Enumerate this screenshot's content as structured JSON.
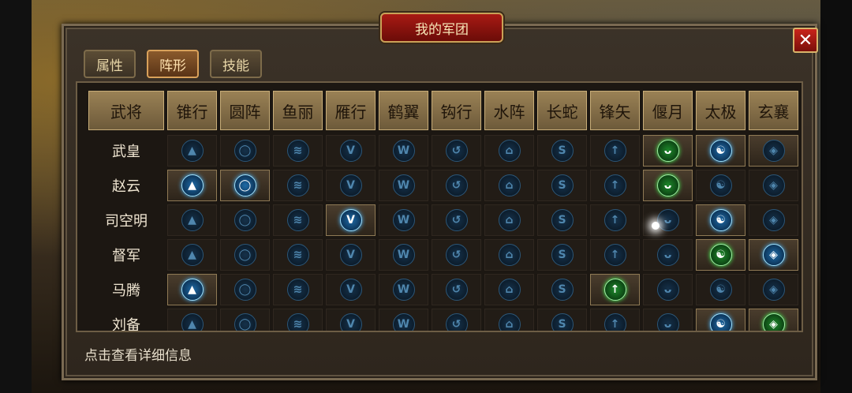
{
  "window": {
    "title": "我的军团",
    "close_label": "✕"
  },
  "tabs": [
    {
      "label": "属性",
      "active": false
    },
    {
      "label": "阵形",
      "active": true
    },
    {
      "label": "技能",
      "active": false
    }
  ],
  "formation_table": {
    "first_header": "武将",
    "columns": [
      "锥行",
      "圆阵",
      "鱼丽",
      "雁行",
      "鹤翼",
      "钩行",
      "水阵",
      "长蛇",
      "锋矢",
      "偃月",
      "太极",
      "玄襄"
    ],
    "icon_glyphs": [
      "▲",
      "◯",
      "≋",
      "V",
      "W",
      "↺",
      "⌂",
      "S",
      "↑",
      "ᴗ",
      "☯",
      "◈"
    ],
    "rows": [
      {
        "name": "武皇",
        "active": [
          false,
          false,
          false,
          false,
          false,
          false,
          false,
          false,
          false,
          true,
          true,
          true
        ],
        "lit": [
          0,
          0,
          0,
          0,
          0,
          0,
          0,
          0,
          0,
          "green",
          "blue",
          0
        ]
      },
      {
        "name": "赵云",
        "active": [
          true,
          true,
          false,
          false,
          false,
          false,
          false,
          false,
          false,
          true,
          false,
          false
        ],
        "lit": [
          "blue",
          "blue",
          0,
          0,
          0,
          0,
          0,
          0,
          0,
          "green",
          0,
          0
        ]
      },
      {
        "name": "司空明",
        "active": [
          false,
          false,
          false,
          true,
          false,
          false,
          false,
          false,
          false,
          false,
          true,
          false
        ],
        "lit": [
          0,
          0,
          0,
          "blue",
          0,
          0,
          0,
          0,
          0,
          0,
          "blue",
          0
        ]
      },
      {
        "name": "督军",
        "active": [
          false,
          false,
          false,
          false,
          false,
          false,
          false,
          false,
          false,
          false,
          true,
          true
        ],
        "lit": [
          0,
          0,
          0,
          0,
          0,
          0,
          0,
          0,
          0,
          0,
          "green",
          "blue"
        ]
      },
      {
        "name": "马腾",
        "active": [
          true,
          false,
          false,
          false,
          false,
          false,
          false,
          false,
          true,
          false,
          false,
          false
        ],
        "lit": [
          "blue",
          0,
          0,
          0,
          0,
          0,
          0,
          0,
          "green",
          0,
          0,
          0
        ]
      },
      {
        "name": "刘备",
        "active": [
          false,
          false,
          false,
          false,
          false,
          false,
          false,
          false,
          false,
          false,
          true,
          true
        ],
        "lit": [
          0,
          0,
          0,
          0,
          0,
          0,
          0,
          0,
          0,
          0,
          "blue",
          "green"
        ]
      }
    ]
  },
  "footer": {
    "hint": "点击查看详细信息"
  }
}
